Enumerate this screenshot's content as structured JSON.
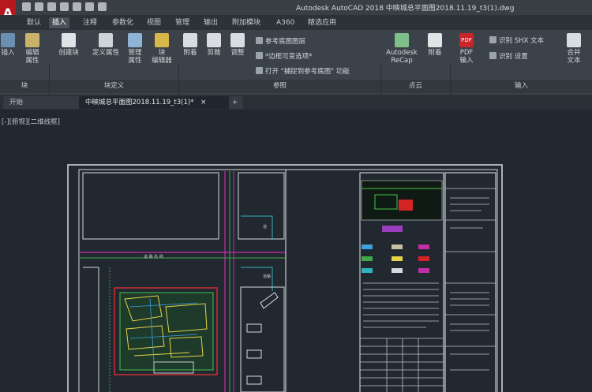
{
  "app": {
    "logo": "A",
    "title": "Autodesk AutoCAD 2018     中映城总平面图2018.11.19_t3(1).dwg"
  },
  "menu_tabs": [
    "默认",
    "插入",
    "注释",
    "参数化",
    "视图",
    "管理",
    "输出",
    "附加模块",
    "A360",
    "精选应用"
  ],
  "active_tab": "插入",
  "ribbon": {
    "block_buttons": [
      "插入",
      "编辑\n属性"
    ],
    "blockdef_buttons": [
      "创建块",
      "定义属性",
      "管理\n属性",
      "块\n编辑器"
    ],
    "ref_buttons": [
      "附着",
      "剪裁",
      "调整"
    ],
    "ref_rows": [
      "参考底图图层",
      "*边框可变选项*",
      "打开 \"捕捉到参考底图\" 功能"
    ],
    "cloud_buttons": [
      "Autodesk\nReCap",
      "附着"
    ],
    "pdf_button": "PDF\n输入",
    "pdf_label": "PDF",
    "import_rows": [
      "识别 SHX 文本",
      "识别 设置"
    ],
    "merge_button": "合并\n文本",
    "panels": [
      "块",
      "块定义",
      "参照",
      "点云",
      "输入"
    ]
  },
  "doc_tabs": [
    "开始",
    "中映城总平面图2018.11.19_t3(1)*"
  ],
  "add_tab": "+",
  "view_label": "[-][俯视][二维线框]",
  "drawing_labels": {
    "road1": "道",
    "road2": "道路",
    "road3": "道  路  名  称"
  },
  "colors": {
    "canvas": "#212830",
    "ribbon": "#3c424a",
    "accent": "#b5191d"
  }
}
